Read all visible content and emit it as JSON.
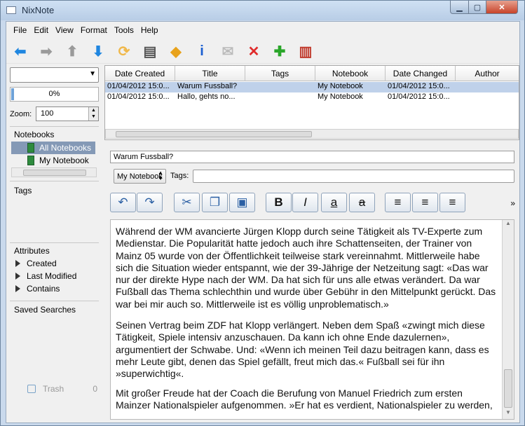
{
  "window": {
    "title": "NixNote",
    "min_label": "▁",
    "max_label": "▢",
    "close_label": "✕"
  },
  "menu": [
    "File",
    "Edit",
    "View",
    "Format",
    "Tools",
    "Help"
  ],
  "toolbar": {
    "icons": [
      "back-arrow-icon",
      "forward-arrow-icon",
      "up-arrow-icon",
      "down-arrow-icon",
      "sync-icon",
      "print-icon",
      "tag-icon",
      "info-icon",
      "email-icon",
      "delete-icon",
      "add-note-icon",
      "notebooks-icon"
    ],
    "glyphs": [
      "⬅",
      "➡",
      "⬆",
      "⬇",
      "⟳",
      "▤",
      "◆",
      "i",
      "✉",
      "✕",
      "✚",
      "▥"
    ],
    "colors": [
      "#1f86e0",
      "#9a9a9a",
      "#9a9a9a",
      "#1f86e0",
      "#f0b84a",
      "#555555",
      "#e8a21b",
      "#1b5fd1",
      "#bbbbbb",
      "#e02b2b",
      "#2aa62a",
      "#c0392b"
    ]
  },
  "left": {
    "combo_value": "",
    "progress": {
      "label": "0%",
      "fraction": 0.0
    },
    "zoom_label": "Zoom:",
    "zoom_value": "100",
    "notebooks_title": "Notebooks",
    "notebooks": [
      "All Notebooks",
      "My Notebook"
    ],
    "tags_title": "Tags",
    "attributes_title": "Attributes",
    "attributes": [
      "Created",
      "Last Modified",
      "Contains"
    ],
    "saved_searches_title": "Saved Searches",
    "trash_label": "Trash",
    "trash_count": "0"
  },
  "notelist": {
    "columns": [
      "Date Created",
      "Title",
      "Tags",
      "Notebook",
      "Date Changed",
      "Author"
    ],
    "rows": [
      {
        "created": "01/04/2012 15:0...",
        "title": "Warum Fussball?",
        "tags": "",
        "notebook": "My Notebook",
        "changed": "01/04/2012 15:0...",
        "author": ""
      },
      {
        "created": "01/04/2012 15:0...",
        "title": "Hallo, gehts no...",
        "tags": "",
        "notebook": "My Notebook",
        "changed": "01/04/2012 15:0...",
        "author": ""
      }
    ]
  },
  "editor": {
    "title": "Warum Fussball?",
    "notebook": "My Notebook",
    "tags_label": "Tags:",
    "tags_value": "",
    "format_buttons": [
      "undo-icon",
      "redo-icon",
      "cut-icon",
      "copy-icon",
      "paste-icon",
      "bold-icon",
      "italic-icon",
      "underline-icon",
      "strikethrough-icon",
      "align-left-icon",
      "align-center-icon",
      "align-right-icon"
    ],
    "format_glyphs": [
      "↶",
      "↷",
      "✂",
      "❐",
      "▣",
      "B",
      "I",
      "a",
      "a",
      "≡",
      "≡",
      "≡"
    ],
    "more_label": "»",
    "paragraphs": [
      "Während der WM avancierte Jürgen Klopp durch seine Tätigkeit als TV-Experte zum Medienstar. Die Popularität hatte jedoch auch ihre Schattenseiten, der Trainer von Mainz 05 wurde von der Öffentlichkeit teilweise stark vereinnahmt. Mittlerweile habe sich die Situation wieder entspannt, wie der 39-Jährige der Netzeitung sagt: «Das war nur der direkte Hype nach der WM. Da hat sich für uns alle etwas verändert. Da war Fußball das Thema schlechthin und wurde über Gebühr in den Mittelpunkt gerückt. Das war bei mir auch so. Mittlerweile ist es völlig unproblematisch.»",
      "Seinen Vertrag beim ZDF hat Klopp verlängert. Neben dem Spaß «zwingt mich diese Tätigkeit, Spiele intensiv anzuschauen. Da kann ich ohne Ende dazulernen», argumentiert der Schwabe. Und: «Wenn ich meinen Teil dazu beitragen kann, dass es mehr Leute gibt, denen das Spiel gefällt, freut mich das.« Fußball sei für ihn »superwichtig«.",
      "Mit großer Freude hat der Coach die Berufung von Manuel Friedrich zum ersten Mainzer Nationalspieler aufgenommen. »Er hat es verdient, Nationalspieler zu werden,"
    ]
  }
}
